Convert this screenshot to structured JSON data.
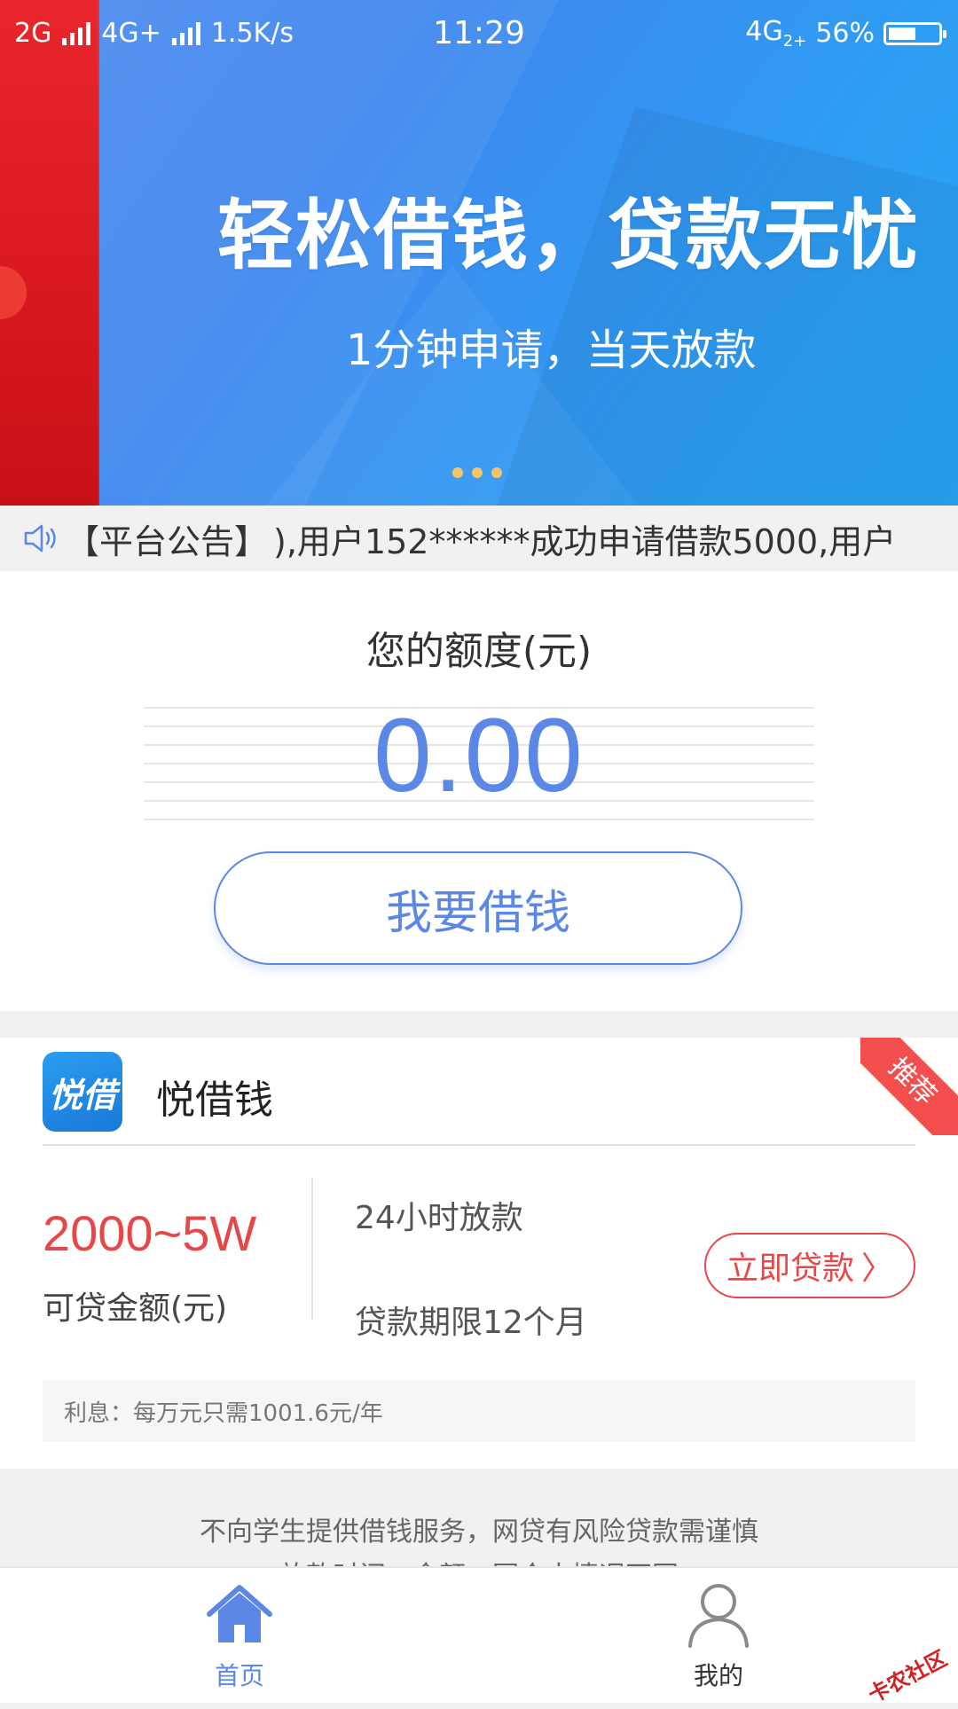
{
  "status_bar": {
    "network1": "2G",
    "network2": "4G+",
    "speed": "1.5K/s",
    "time": "11:29",
    "network3": "4G",
    "network3_sub": "2+",
    "battery": "56%",
    "battery_level": 0.56
  },
  "banner": {
    "headline": "轻松借钱，贷款无忧",
    "subline": "1分钟申请，当天放款",
    "dots": 3
  },
  "notice": {
    "tag": "【平台公告】",
    "text": "),用户152******成功申请借款5000,用户"
  },
  "quota": {
    "label": "您的额度(元)",
    "amount": "0.00",
    "button": "我要借钱"
  },
  "product": {
    "logo_text": "悦借",
    "name": "悦借钱",
    "ribbon": "推荐",
    "range": "2000~5W",
    "range_label": "可贷金额(元)",
    "feature_1": "24小时放款",
    "feature_2": "贷款期限12个月",
    "apply_button": "立即贷款",
    "apply_arrow": "〉",
    "interest": "利息：每万元只需1001.6元/年"
  },
  "disclaimer": {
    "line_1": "不向学生提供借钱服务，网贷有风险贷款需谨慎",
    "line_2": "放款时间、金额、因个人情况不同"
  },
  "tabbar": {
    "home": "首页",
    "mine": "我的"
  },
  "watermark": "卡农社区",
  "colors": {
    "accent": "#5b87e6",
    "red": "#e8474a",
    "banner_blue": "#3f88ee"
  }
}
